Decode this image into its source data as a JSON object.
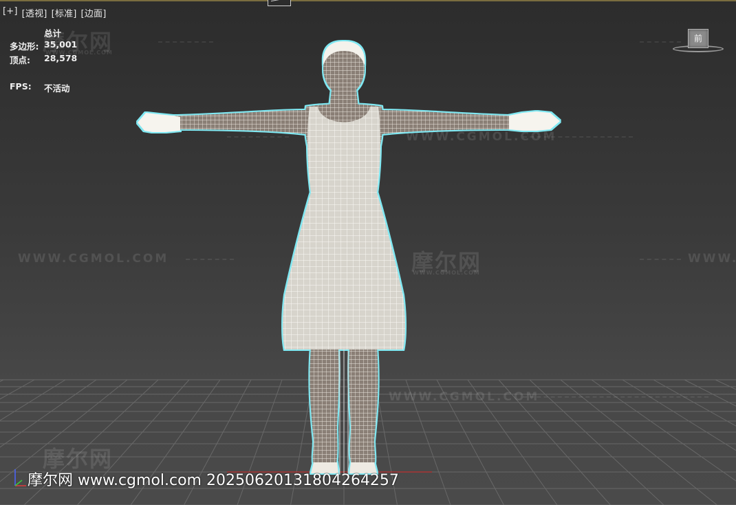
{
  "viewport": {
    "menu": [
      "[+]",
      "[透视]",
      "[标准]",
      "[边面]"
    ]
  },
  "stats": {
    "header": "总计",
    "polygons_label": "多边形:",
    "polygons_value": "35,001",
    "vertices_label": "顶点:",
    "vertices_value": "28,578",
    "fps_label": "FPS:",
    "fps_value": "不活动"
  },
  "viewcube": {
    "face_label": "前"
  },
  "watermarks": {
    "logo": "摩尔网",
    "url": "WWW.CGMOL.COM",
    "small_url": "WWW.CGMOL.COM"
  },
  "footer": {
    "text": "摩尔网 www.cgmol.com 20250620131804264257"
  },
  "colors": {
    "background_top": "#2c2c2c",
    "background_bottom": "#4a4a4a",
    "grid_line": "#6e6e6e",
    "wire": "#f2f0ea",
    "selection_outline": "#7fe8f2"
  }
}
